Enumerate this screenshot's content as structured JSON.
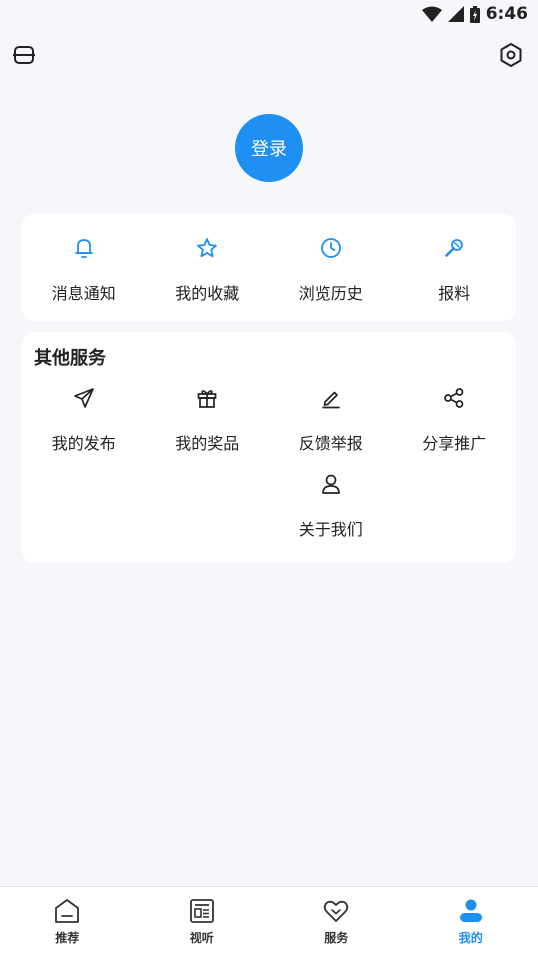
{
  "status_bar": {
    "time": "6:46"
  },
  "login": {
    "label": "登录"
  },
  "quick_actions": [
    {
      "label": "消息通知",
      "icon": "bell-icon"
    },
    {
      "label": "我的收藏",
      "icon": "star-icon"
    },
    {
      "label": "浏览历史",
      "icon": "clock-icon"
    },
    {
      "label": "报料",
      "icon": "microphone-icon"
    }
  ],
  "services": {
    "title": "其他服务",
    "items": [
      {
        "label": "我的发布",
        "icon": "paper-plane-icon"
      },
      {
        "label": "我的奖品",
        "icon": "gift-icon"
      },
      {
        "label": "反馈举报",
        "icon": "pencil-icon"
      },
      {
        "label": "分享推广",
        "icon": "share-icon"
      },
      {
        "label": "关于我们",
        "icon": "user-icon"
      }
    ]
  },
  "bottom_nav": [
    {
      "label": "推荐",
      "icon": "home-icon",
      "active": false
    },
    {
      "label": "视听",
      "icon": "news-icon",
      "active": false
    },
    {
      "label": "服务",
      "icon": "heart-icon",
      "active": false
    },
    {
      "label": "我的",
      "icon": "profile-icon",
      "active": true
    }
  ],
  "colors": {
    "accent": "#1e8ff3",
    "background": "#f5f7fa",
    "card": "#ffffff"
  }
}
